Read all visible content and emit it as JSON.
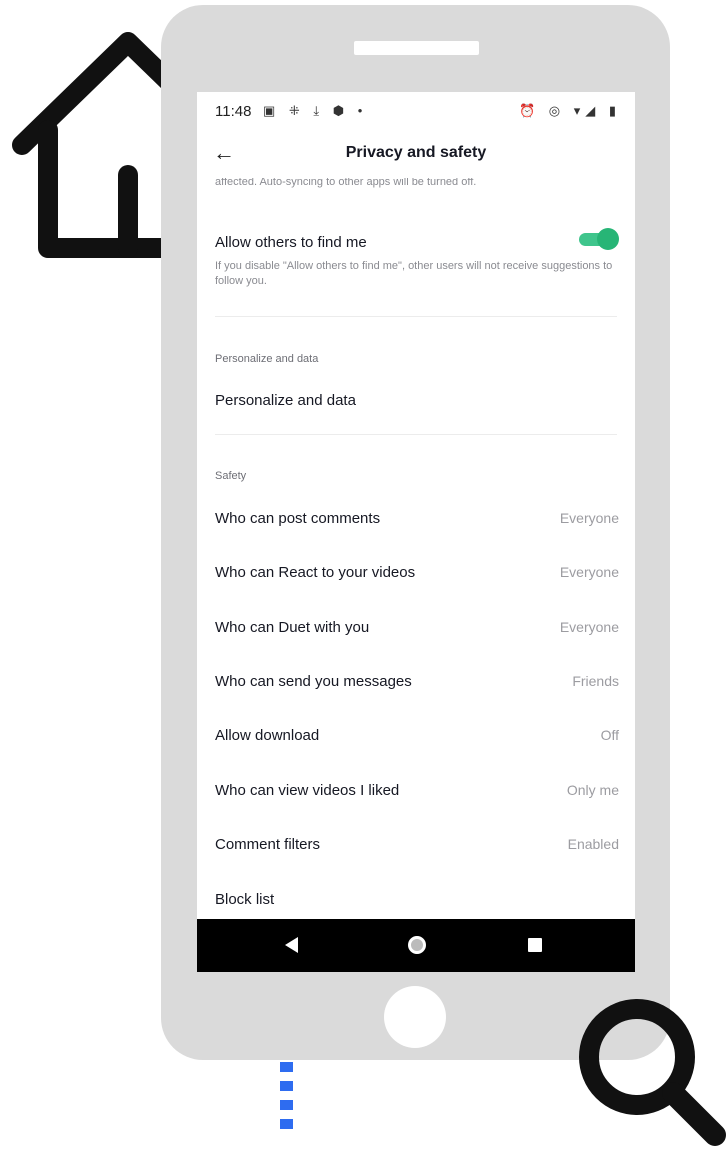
{
  "colors": {
    "toggle_on": "#27b576",
    "dots": "#2e6cf0",
    "phone_body": "#dadada"
  },
  "status_bar": {
    "time": "11:48",
    "left_icons": "▣ ⁜ ⤓ ⬢ •",
    "right_icons": "⏰ ◎ ▾◢ ▮"
  },
  "header": {
    "title": "Privacy and safety",
    "back_icon": "←"
  },
  "truncated_text": "affected. Auto-syncing to other apps will be turned off.",
  "find_me": {
    "label": "Allow others to find me",
    "description": "If you disable \"Allow others to find me\", other users will not receive suggestions to follow you.",
    "enabled": true
  },
  "personalize": {
    "section_label": "Personalize and data",
    "item_label": "Personalize and data"
  },
  "safety": {
    "section_label": "Safety",
    "items": [
      {
        "label": "Who can post comments",
        "value": "Everyone"
      },
      {
        "label": "Who can React to your videos",
        "value": "Everyone"
      },
      {
        "label": "Who can Duet with you",
        "value": "Everyone"
      },
      {
        "label": "Who can send you messages",
        "value": "Friends"
      },
      {
        "label": "Allow download",
        "value": "Off"
      },
      {
        "label": "Who can view videos I liked",
        "value": "Only me"
      },
      {
        "label": "Comment filters",
        "value": "Enabled"
      },
      {
        "label": "Block list",
        "value": ""
      }
    ]
  }
}
